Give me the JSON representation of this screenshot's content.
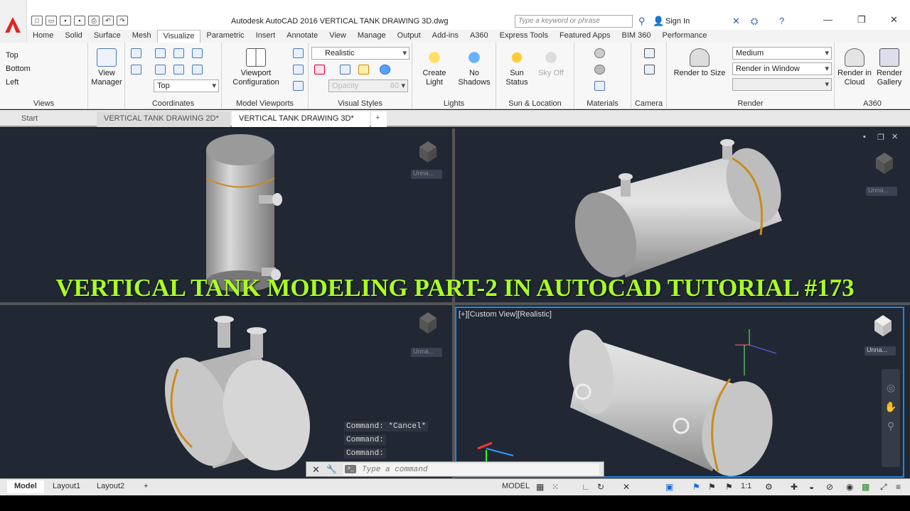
{
  "window": {
    "title": "Autodesk AutoCAD 2016    VERTICAL TANK DRAWING 3D.dwg",
    "search_placeholder": "Type a keyword or phrase",
    "sign_in": "Sign In"
  },
  "ribbon_tabs": [
    "Home",
    "Solid",
    "Surface",
    "Mesh",
    "Visualize",
    "Parametric",
    "Insert",
    "Annotate",
    "View",
    "Manage",
    "Output",
    "Add-ins",
    "A360",
    "Express Tools",
    "Featured Apps",
    "BIM 360",
    "Performance"
  ],
  "active_ribbon_tab": "Visualize",
  "panels": {
    "views": {
      "title": "Views",
      "items": [
        "Top",
        "Bottom",
        "Left"
      ],
      "view_manager": "View Manager"
    },
    "coordinates": {
      "title": "Coordinates",
      "ucs_value": "Top"
    },
    "model_viewports": {
      "title": "Model Viewports",
      "viewport_config": "Viewport Configuration"
    },
    "visual_styles": {
      "title": "Visual Styles",
      "style_value": "Realistic",
      "opacity_label": "Opacity",
      "opacity_value": "60"
    },
    "lights": {
      "title": "Lights",
      "create_light": "Create Light",
      "no_shadows": "No Shadows"
    },
    "sun_location": {
      "title": "Sun & Location",
      "sun_status": "Sun Status",
      "sky_off": "Sky Off"
    },
    "materials": {
      "title": "Materials"
    },
    "camera": {
      "title": "Camera"
    },
    "render": {
      "title": "Render",
      "render_to_size": "Render to Size",
      "quality": "Medium",
      "render_in": "Render in Window"
    },
    "a360": {
      "title": "A360",
      "render_cloud": "Render in Cloud",
      "render_gallery": "Render Gallery"
    }
  },
  "doc_tabs": [
    "Start",
    "VERTICAL TANK DRAWING 2D*",
    "VERTICAL TANK DRAWING 3D*"
  ],
  "viewport_label": "[+][Custom View][Realistic]",
  "viewcube_label": "Unna...",
  "overlay_title": "VERTICAL TANK MODELING PART-2 IN AUTOCAD TUTORIAL #173",
  "command_history": [
    "Command: *Cancel*",
    "Command:",
    "Command:"
  ],
  "command_placeholder": "Type a command",
  "layout_tabs": [
    "Model",
    "Layout1",
    "Layout2"
  ],
  "status": {
    "space": "MODEL",
    "scale": "1:1"
  }
}
